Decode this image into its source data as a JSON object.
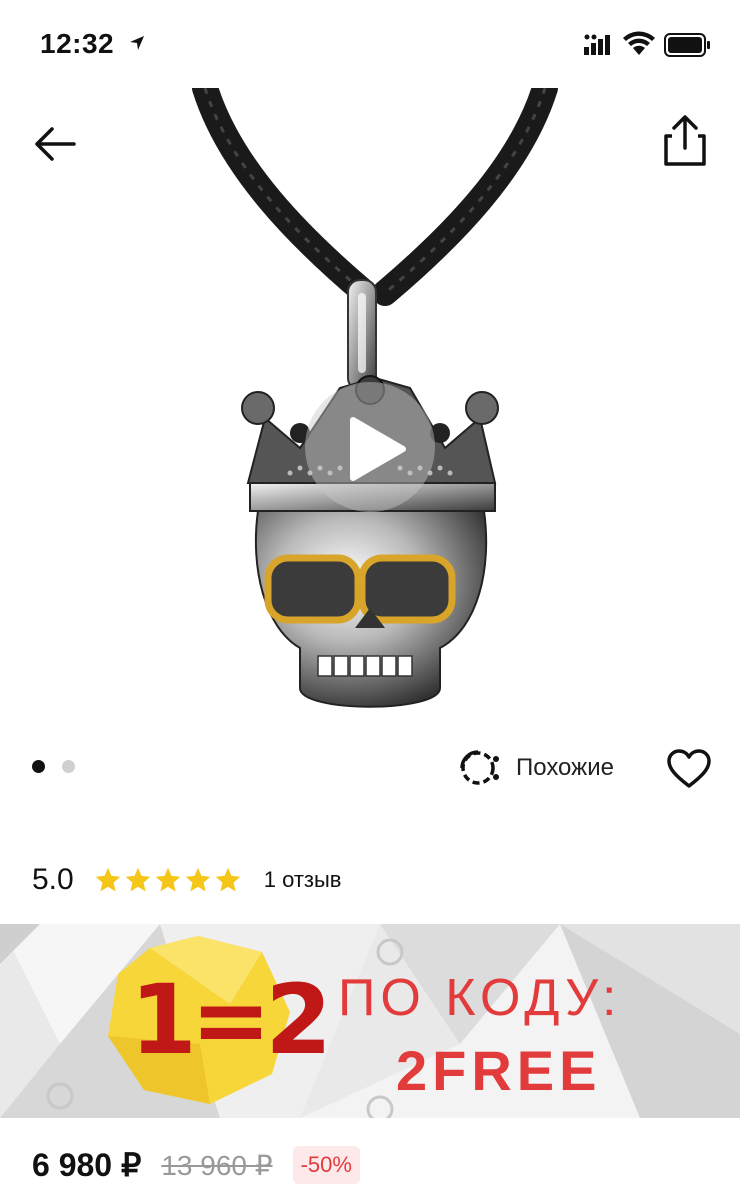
{
  "status_bar": {
    "time": "12:32"
  },
  "product": {
    "gallery": {
      "total_images": 2,
      "active_index": 0
    },
    "similar_label": "Похожие",
    "rating": {
      "score": "5.0",
      "stars": 5,
      "reviews": "1 отзыв"
    },
    "price": "6 980 ₽",
    "old_price": "13 960 ₽",
    "discount": "-50%"
  },
  "promo": {
    "badge": "1=2",
    "line1": "ПО КОДУ:",
    "line2": "2FREE"
  },
  "colors": {
    "accent_red": "#e23b3b",
    "star": "#f5c518",
    "badge_yellow": "#f7d63a"
  }
}
